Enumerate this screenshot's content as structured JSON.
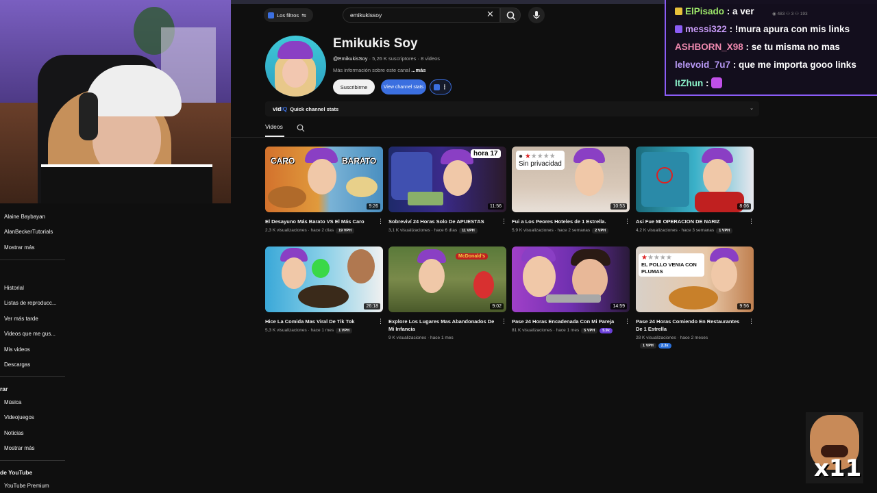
{
  "search": {
    "query": "emikukissoy",
    "filters_label": "Los filtros"
  },
  "channel": {
    "name": "Emikukis Soy",
    "handle": "@EmikukisSoy",
    "meta": "· 5,26 K suscriptores · 8 videos",
    "about": "Más información sobre este canal",
    "about_more": "...más",
    "subscribe_label": "Suscribirme",
    "stats_label": "View channel stats"
  },
  "vidiq": {
    "logo_text": "vid",
    "logo_accent": "IQ",
    "label": "Quick channel stats"
  },
  "tabs": {
    "videos": "Videos"
  },
  "sidebar": {
    "subs": [
      "Alaine Baybayan",
      "AlanBeckerTutorials"
    ],
    "show_more": "Mostrar más",
    "you": [
      "Historial",
      "Listas de reproducc...",
      "Ver más tarde",
      "Videos que me gus...",
      "Mis videos",
      "Descargas"
    ],
    "explore_head": "rar",
    "explore": [
      "Música",
      "Videojuegos",
      "Noticias"
    ],
    "show_more_2": "Mostrar más",
    "yt_head": "de YouTube",
    "yt_items": [
      "YouTube Premium"
    ]
  },
  "videos": [
    {
      "title": "El Desayuno Más Barato VS El Más Caro",
      "meta": "2,3 K visualizaciones · hace 2 días",
      "vph": "19 VPH",
      "duration": "9:26",
      "thumb_text_left": "CARO",
      "thumb_text_right": "BARATO"
    },
    {
      "title": "Sobreviví 24 Horas Solo De APUESTAS",
      "meta": "3,1 K visualizaciones · hace 6 días",
      "vph": "11 VPH",
      "duration": "11:56",
      "thumb_text": "hora 17"
    },
    {
      "title": "Fui a Los Peores Hoteles de 1 Estrella.",
      "meta": "5,9 K visualizaciones · hace 2 semanas",
      "vph": "2 VPH",
      "duration": "10:53",
      "thumb_text": "Sin privacidad"
    },
    {
      "title": "Asi Fue MI OPERACION DE NARIZ",
      "meta": "4,2 K visualizaciones · hace 3 semanas",
      "vph": "1 VPH",
      "duration": "8:06"
    },
    {
      "title": "Hice La Comida Mas Viral De Tik Tok",
      "meta": "5,3 K visualizaciones · hace 1 mes",
      "vph": "1 VPH",
      "duration": "26:18"
    },
    {
      "title": "Explore Los Lugares Mas Abandonados De Mi Infancia",
      "meta": "9 K visualizaciones · hace 1 mes",
      "duration": "9:02",
      "thumb_text": "McDonald's"
    },
    {
      "title": "Pase 24 Horas Encadenada Con Mi Pareja",
      "meta": "81 K visualizaciones · hace 1 mes",
      "vph": "5 VPH",
      "multiplier": "5.9x",
      "duration": "14:59"
    },
    {
      "title": "Pase 24 Horas Comiendo En Restaurantes De 1 Estrella",
      "meta": "28 K visualizaciones · hace 2 meses",
      "vph": "1 VPH",
      "multiplier": "2.3x",
      "duration": "9:56",
      "thumb_text": "EL POLLO VENIA CON PLUMAS"
    }
  ],
  "chat": {
    "stats": "◉ 483   ⚇ 3   ⚇ 193",
    "messages": [
      {
        "user": "ElPisado",
        "text": ": a ver",
        "color": "#9ee86a"
      },
      {
        "user": "messi322",
        "text": ": !mura apura con mis links",
        "color": "#c89bf7"
      },
      {
        "user": "ASHBORN_X98",
        "text": ": se tu misma no mas",
        "color": "#f08ab0"
      },
      {
        "user": "lelevoid_7u7",
        "text": ": que me importa gooo links",
        "color": "#b99af7"
      },
      {
        "user": "ItZhun",
        "text": " : ",
        "color": "#8af0c8"
      }
    ]
  },
  "emote": {
    "count": "x11"
  },
  "colors": {
    "accent": "#3b6fe0",
    "chat_border": "#8b5cf6",
    "bg": "#0f0f0f"
  }
}
